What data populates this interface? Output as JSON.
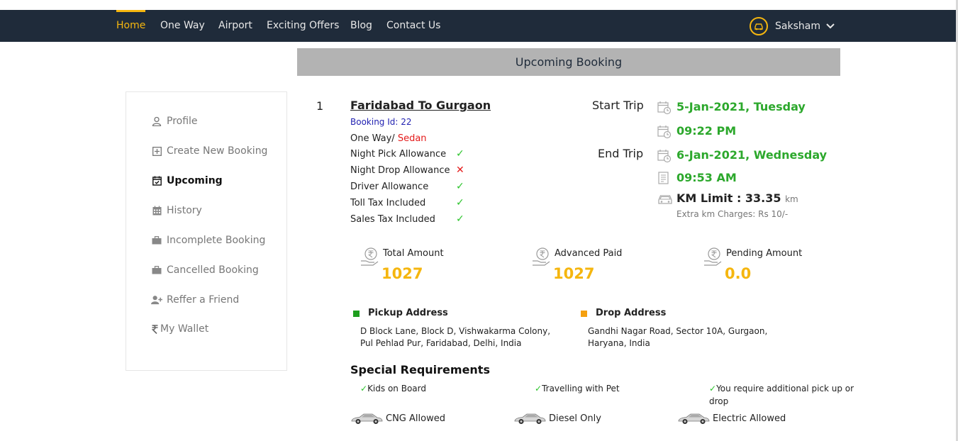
{
  "nav": {
    "items": [
      "Home",
      "One Way",
      "Airport",
      "Exciting Offers",
      "Blog",
      "Contact Us"
    ],
    "user": "Saksham"
  },
  "banner": "Upcoming Booking",
  "sidebar": {
    "items": [
      {
        "label": "Profile",
        "icon": "user-icon"
      },
      {
        "label": "Create New Booking",
        "icon": "plus-square-icon"
      },
      {
        "label": "Upcoming",
        "icon": "calendar-check-icon"
      },
      {
        "label": "History",
        "icon": "calendar-icon"
      },
      {
        "label": "Incomplete Booking",
        "icon": "briefcase-icon"
      },
      {
        "label": "Cancelled Booking",
        "icon": "briefcase-icon"
      },
      {
        "label": "Reffer a Friend",
        "icon": "user-plus-icon"
      },
      {
        "label": "My Wallet",
        "icon": "rupee-icon"
      }
    ]
  },
  "booking": {
    "index": "1",
    "route": "Faridabad To Gurgaon",
    "booking_id": "Booking Id: 22",
    "trip_type": "One Way/",
    "car_type": "Sedan",
    "allowances": [
      {
        "label": "Night Pick Allowance",
        "included": true,
        "mark": "✓"
      },
      {
        "label": "Night Drop Allowance",
        "included": false,
        "mark": "✕"
      },
      {
        "label": "Driver Allowance",
        "included": true,
        "mark": "✓"
      },
      {
        "label": "Toll Tax Included",
        "included": true,
        "mark": "✓"
      },
      {
        "label": "Sales Tax Included",
        "included": true,
        "mark": "✓"
      }
    ],
    "start_trip_label": "Start Trip",
    "start_date": "5-Jan-2021, Tuesday",
    "start_time": "09:22 PM",
    "end_trip_label": "End Trip",
    "end_date": "6-Jan-2021, Wednesday",
    "end_time": "09:53 AM",
    "km_limit_label": "KM Limit : 33.35",
    "km_unit": "km",
    "extra_charges": "Extra km Charges: Rs 10/-",
    "amounts": [
      {
        "label": "Total Amount",
        "value": "1027"
      },
      {
        "label": "Advanced Paid",
        "value": "1027"
      },
      {
        "label": "Pending Amount",
        "value": "0.0"
      }
    ],
    "pickup": {
      "title": "Pickup Address",
      "line1": "D Block Lane, Block D, Vishwakarma Colony,",
      "line2": "Pul Pehlad Pur, Faridabad, Delhi, India",
      "color": "#1e9e1e"
    },
    "drop": {
      "title": "Drop Address",
      "line1": "Gandhi Nagar Road, Sector 10A, Gurgaon,",
      "line2": "Haryana, India",
      "color": "#f5a00f"
    },
    "special_title": "Special Requirements",
    "requirements": [
      {
        "mark": "✓",
        "label": "Kids on Board"
      },
      {
        "mark": "✓",
        "label": "Travelling with Pet"
      },
      {
        "mark": "✓",
        "label": "You require additional pick up or drop"
      }
    ],
    "fuel": [
      "CNG Allowed",
      "Diesel Only",
      "Electric Allowed"
    ]
  },
  "colors": {
    "accent": "#f5b60f",
    "navbar": "#1f2b3a",
    "green": "#2ca82c",
    "red": "#e41a1a"
  }
}
